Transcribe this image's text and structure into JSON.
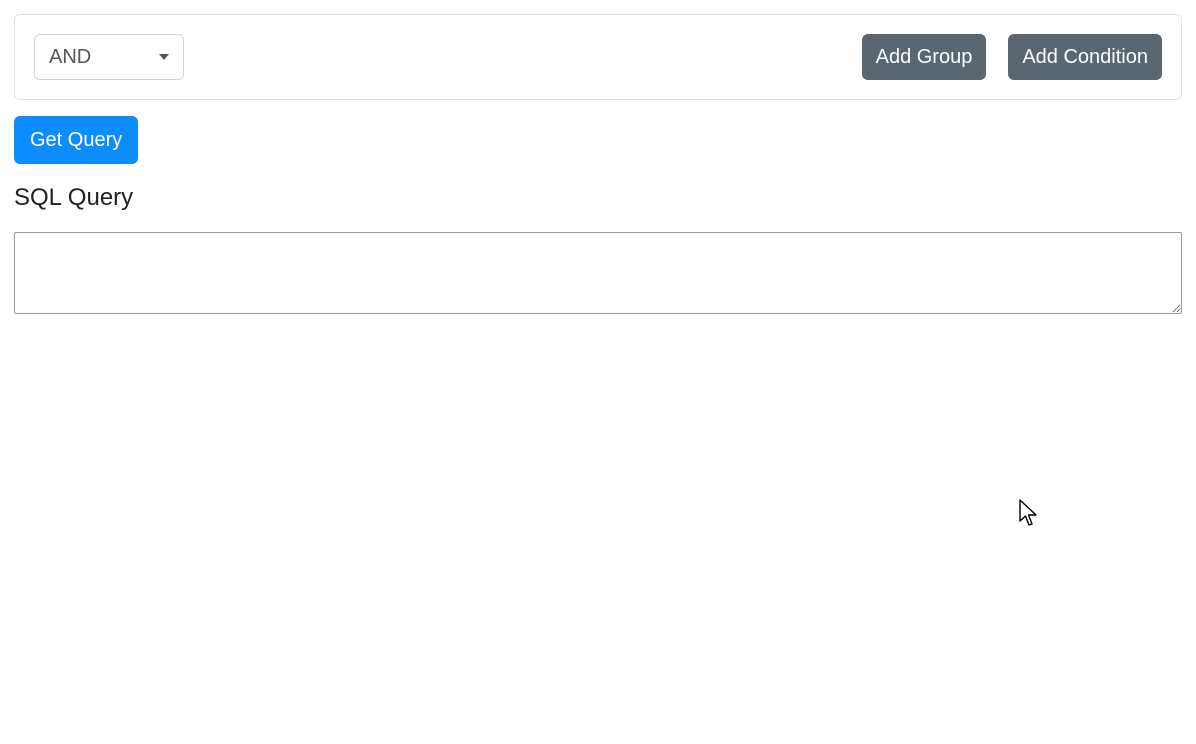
{
  "builder": {
    "combinator": "AND",
    "buttons": {
      "add_group": "Add Group",
      "add_condition": "Add Condition"
    }
  },
  "actions": {
    "get_query": "Get Query"
  },
  "output": {
    "heading": "SQL Query",
    "value": ""
  }
}
